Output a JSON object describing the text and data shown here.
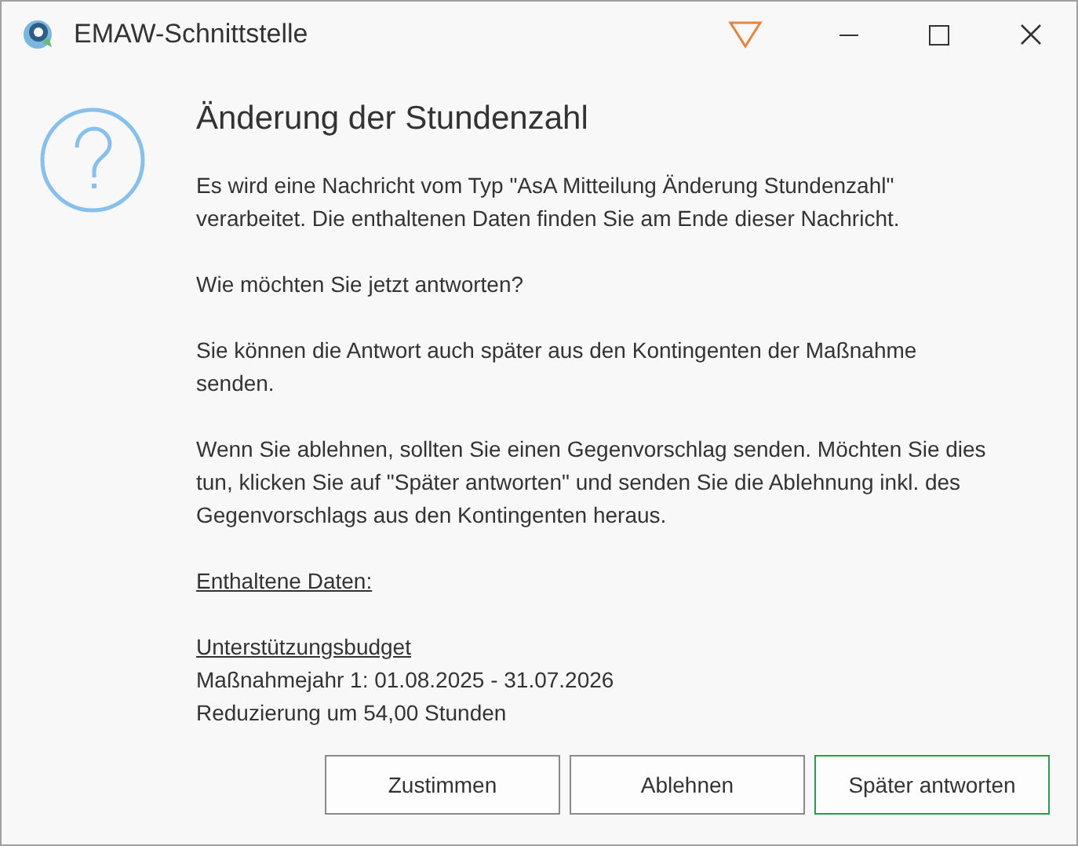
{
  "window": {
    "title": "EMAW-Schnittstelle"
  },
  "dialog": {
    "title": "Änderung der Stundenzahl",
    "paragraphs": [
      {
        "lines": [
          "Es wird eine Nachricht vom Typ \"AsA Mitteilung Änderung Stundenzahl\"",
          "verarbeitet. Die enthaltenen Daten finden Sie am Ende dieser Nachricht."
        ]
      },
      {
        "lines": [
          "Wie möchten Sie jetzt antworten?"
        ]
      },
      {
        "lines": [
          "Sie können die Antwort auch später aus den Kontingenten der Maßnahme",
          "senden."
        ]
      },
      {
        "lines": [
          "Wenn Sie ablehnen, sollten Sie einen Gegenvorschlag senden. Möchten Sie dies",
          "tun, klicken Sie auf \"Später antworten\" und senden Sie die Ablehnung inkl. des",
          "Gegenvorschlags aus den Kontingenten heraus."
        ]
      }
    ],
    "data_section": {
      "label": "Enthaltene Daten:",
      "subtitle": "Unterstützungsbudget",
      "lines": [
        "Maßnahmejahr 1: 01.08.2025 - 31.07.2026",
        "Reduzierung um 54,00 Stunden"
      ]
    },
    "buttons": [
      {
        "label": "Zustimmen",
        "default": false
      },
      {
        "label": "Ablehnen",
        "default": false
      },
      {
        "label": "Später antworten",
        "default": true
      }
    ]
  }
}
